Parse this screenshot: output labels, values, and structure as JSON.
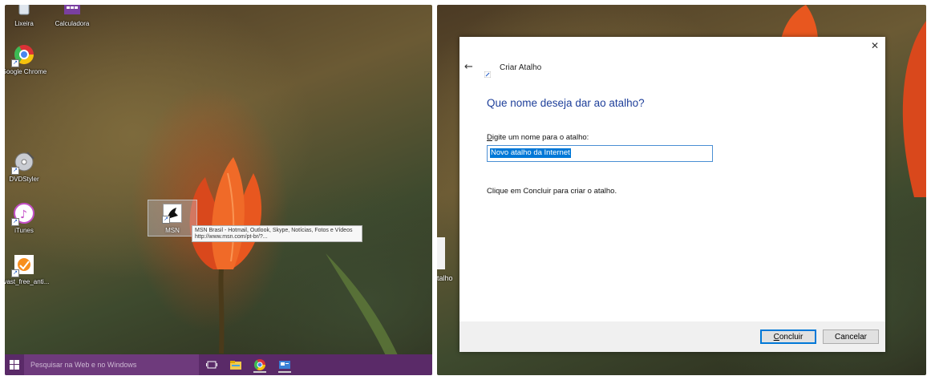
{
  "desktop": {
    "icons": [
      {
        "label": "Lixeira",
        "icon": "recycle-bin-icon"
      },
      {
        "label": "Calculadora",
        "icon": "calculator-icon"
      },
      {
        "label": "Google Chrome",
        "icon": "chrome-icon"
      },
      {
        "label": "DVDStyler",
        "icon": "dvd-icon"
      },
      {
        "label": "iTunes",
        "icon": "itunes-icon"
      },
      {
        "label": "avast_free_anti...",
        "icon": "avast-icon"
      }
    ],
    "dragged_icon": {
      "label": "MSN",
      "icon": "msn-shortcut-icon"
    },
    "tooltip": {
      "line1": "MSN Brasil - Hotmail, Outlook, Skype, Notícias, Fotos e Vídeos",
      "line2": "http://www.msn.com/pt-br/?..."
    },
    "taskbar": {
      "search_placeholder": "Pesquisar na Web e no Windows",
      "items": [
        "task-view-icon",
        "file-explorer-icon",
        "chrome-icon",
        "shortcut-app-icon"
      ]
    },
    "partial_icon_label": "talho"
  },
  "dialog": {
    "title": "Criar Atalho",
    "heading": "Que nome deseja dar ao atalho?",
    "field_label_accel": "D",
    "field_label_rest": "igite um nome para o atalho:",
    "field_value": "Novo atalho da Internet",
    "instruction": "Clique em Concluir para criar o atalho.",
    "finish_accel": "C",
    "finish_rest": "oncluir",
    "cancel_label": "Cancelar",
    "close_glyph": "✕",
    "back_glyph": "←"
  },
  "colors": {
    "heading": "#1e3f9a",
    "taskbar": "#5a2a68",
    "selection": "#0078d7"
  }
}
